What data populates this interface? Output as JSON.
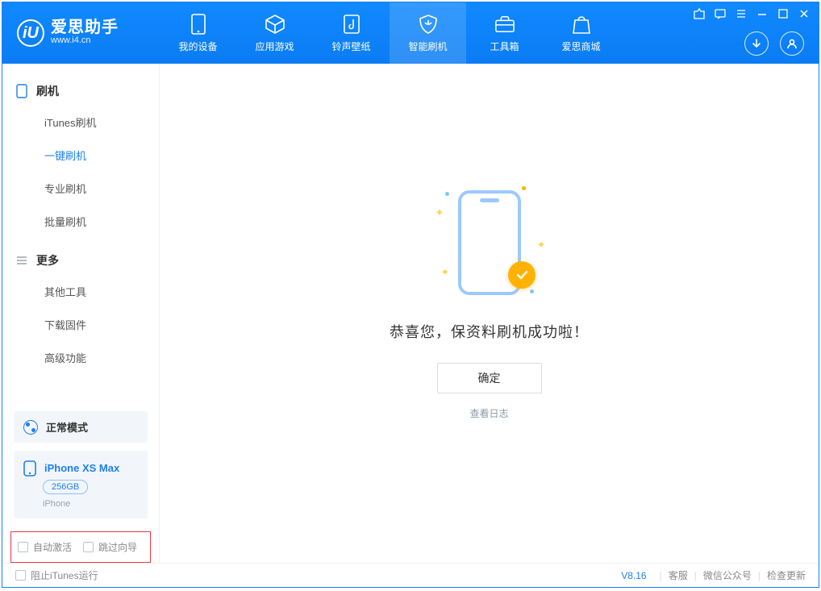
{
  "app": {
    "name_cn": "爱思助手",
    "name_en": "www.i4.cn",
    "logo_letter": "iU"
  },
  "nav": {
    "items": [
      {
        "label": "我的设备",
        "icon": "device"
      },
      {
        "label": "应用游戏",
        "icon": "cube"
      },
      {
        "label": "铃声壁纸",
        "icon": "music"
      },
      {
        "label": "智能刷机",
        "icon": "shield"
      },
      {
        "label": "工具箱",
        "icon": "toolbox"
      },
      {
        "label": "爱思商城",
        "icon": "bag"
      }
    ],
    "active_index": 3
  },
  "sidebar": {
    "groups": [
      {
        "header": "刷机",
        "items": [
          {
            "label": "iTunes刷机"
          },
          {
            "label": "一键刷机"
          },
          {
            "label": "专业刷机"
          },
          {
            "label": "批量刷机"
          }
        ],
        "active_index": 1
      },
      {
        "header": "更多",
        "items": [
          {
            "label": "其他工具"
          },
          {
            "label": "下载固件"
          },
          {
            "label": "高级功能"
          }
        ],
        "active_index": -1
      }
    ]
  },
  "mode": {
    "label": "正常模式"
  },
  "device": {
    "name": "iPhone XS Max",
    "storage": "256GB",
    "subtype": "iPhone"
  },
  "checkboxes": {
    "auto_activate": "自动激活",
    "skip_guide": "跳过向导"
  },
  "main": {
    "success_title": "恭喜您，保资料刷机成功啦！",
    "ok_button": "确定",
    "view_log": "查看日志"
  },
  "statusbar": {
    "block_itunes": "阻止iTunes运行",
    "version": "V8.16",
    "links": [
      "客服",
      "微信公众号",
      "检查更新"
    ]
  }
}
